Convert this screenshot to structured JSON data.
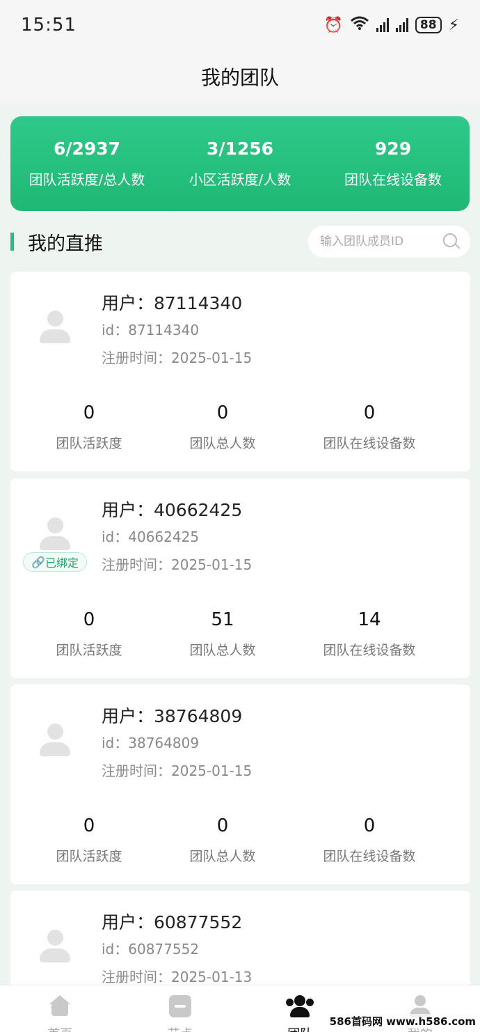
{
  "status_bar": {
    "time": "15:51",
    "battery": "88"
  },
  "header": {
    "title": "我的团队"
  },
  "summary": [
    {
      "value": "6/2937",
      "label": "团队活跃度/总人数"
    },
    {
      "value": "3/1256",
      "label": "小区活跃度/人数"
    },
    {
      "value": "929",
      "label": "团队在线设备数"
    }
  ],
  "section": {
    "title": "我的直推"
  },
  "search": {
    "placeholder": "输入团队成员ID"
  },
  "members": [
    {
      "user": "用户：87114340",
      "id": "id：87114340",
      "registered": "注册时间：2025-01-15",
      "bound": "",
      "stats": [
        {
          "value": "0",
          "label": "团队活跃度"
        },
        {
          "value": "0",
          "label": "团队总人数"
        },
        {
          "value": "0",
          "label": "团队在线设备数"
        }
      ]
    },
    {
      "user": "用户：40662425",
      "id": "id：40662425",
      "registered": "注册时间：2025-01-15",
      "bound": "已绑定",
      "stats": [
        {
          "value": "0",
          "label": "团队活跃度"
        },
        {
          "value": "51",
          "label": "团队总人数"
        },
        {
          "value": "14",
          "label": "团队在线设备数"
        }
      ]
    },
    {
      "user": "用户：38764809",
      "id": "id：38764809",
      "registered": "注册时间：2025-01-15",
      "bound": "",
      "stats": [
        {
          "value": "0",
          "label": "团队活跃度"
        },
        {
          "value": "0",
          "label": "团队总人数"
        },
        {
          "value": "0",
          "label": "团队在线设备数"
        }
      ]
    },
    {
      "user": "用户：60877552",
      "id": "id：60877552",
      "registered": "注册时间：2025-01-13",
      "bound": "",
      "stats": []
    }
  ],
  "tabs": [
    {
      "label": "首页",
      "icon": "home-icon"
    },
    {
      "label": "节点",
      "icon": "node-icon"
    },
    {
      "label": "团队",
      "icon": "team-icon"
    },
    {
      "label": "我的",
      "icon": "me-icon"
    }
  ],
  "watermark": "586首码网 www.h586.com"
}
